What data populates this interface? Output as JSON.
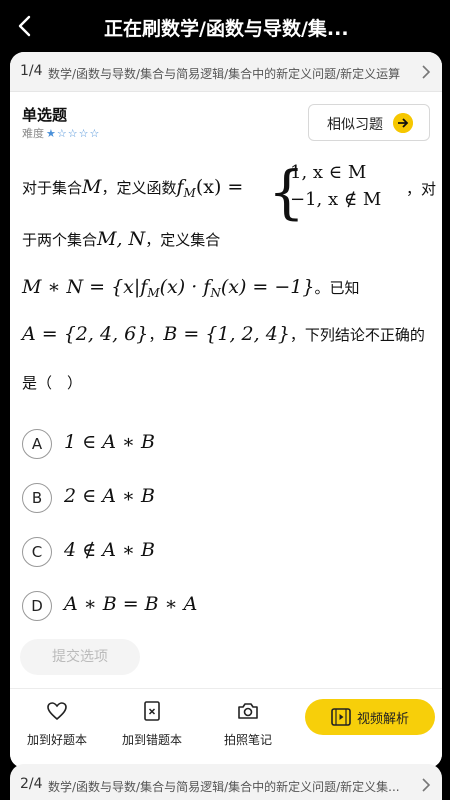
{
  "header": {
    "title": "正在刷数学/函数与导数/集..."
  },
  "card1": {
    "index": "1/4",
    "breadcrumb": "数学/函数与导数/集合与简易逻辑/集合中的新定义问题/新定义运算"
  },
  "question": {
    "type": "单选题",
    "difficulty_label": "难度",
    "difficulty_stars": 1,
    "difficulty_max": 5,
    "similar_label": "相似习题",
    "line1_pre": "对于集合",
    "line1_M": "M",
    "line1_comma": "，定义函数",
    "line1_f": "f",
    "line1_fsub": "M",
    "line1_arg": "(x) =",
    "case1": "1, x ∈ M",
    "case2": "−1, x ∉ M",
    "line1_post": "，对",
    "line2_pre": "于两个集合",
    "line2_MN": "M, N",
    "line2_post": "，定义集合",
    "line3_math": "M ∗ N = {x|f",
    "line3_sub1": "M",
    "line3_mid": "(x) · f",
    "line3_sub2": "N",
    "line3_end": "(x) = −1}",
    "line3_post": "。已知",
    "line4_A": "A = {2, 4, 6}",
    "line4_comma": "，",
    "line4_B": "B = {1, 2, 4}",
    "line4_post": "，下列结论不正确的",
    "line5": "是（　）"
  },
  "options": [
    {
      "letter": "A",
      "text": "1 ∈ A ∗ B"
    },
    {
      "letter": "B",
      "text": "2 ∈ A ∗ B"
    },
    {
      "letter": "C",
      "text": "4 ∉ A ∗ B"
    },
    {
      "letter": "D",
      "text": "A ∗ B = B ∗ A"
    }
  ],
  "submit_label": "提交选项",
  "toolbar": {
    "favorite_label": "加到好题本",
    "mistake_label": "加到错题本",
    "photo_label": "拍照笔记",
    "video_label": "视频解析"
  },
  "card2": {
    "index": "2/4",
    "breadcrumb": "数学/函数与导数/集合与简易逻辑/集合中的新定义问题/新定义集..."
  },
  "colors": {
    "accent": "#f7cf0a",
    "star": "#4a90d9",
    "background": "#000000"
  },
  "icons": [
    "back-arrow-icon",
    "chevron-right-icon",
    "arrow-right-icon",
    "heart-icon",
    "mistake-book-icon",
    "camera-icon",
    "video-play-icon",
    "star-icon"
  ]
}
